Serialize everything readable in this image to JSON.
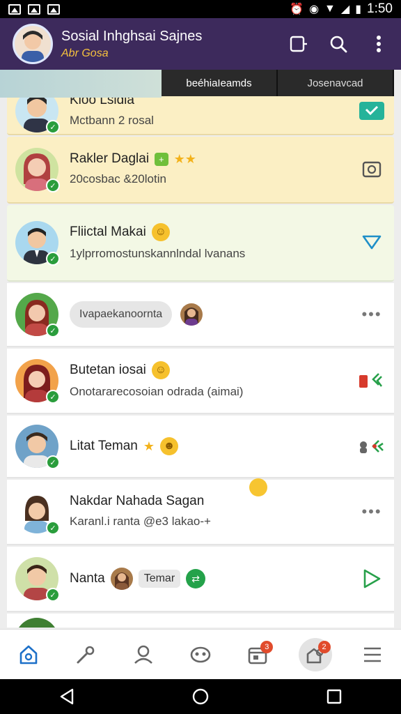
{
  "status_bar": {
    "time": "1:50"
  },
  "header": {
    "title": "Sosial Inhghsai Sajnes",
    "subtitle": "Abr Gosa",
    "accent": "#3d2a5c"
  },
  "tabs": [
    {
      "label": "beéhiaIeamds"
    },
    {
      "label": "Josenavcad"
    }
  ],
  "chats": [
    {
      "name": "Kloo Lsidia",
      "message": "Mctbann 2 rosal",
      "action_icon": "check-icon"
    },
    {
      "name": "Rakler Daglai",
      "message": "20cosbac &20lotin",
      "tag": "+",
      "action_icon": "camera-icon"
    },
    {
      "name": "Fliictal Makai",
      "message": "1ylprromostunskannlndal lvanans",
      "action_icon": "send-icon"
    },
    {
      "chip": "Ivapaekanoornta",
      "action_icon": "more-icon"
    },
    {
      "name": "Butetan iosai",
      "message": "Onotararecosoian odrada (aimai)",
      "action_icon": "share-icon"
    },
    {
      "name": "Litat Teman",
      "action_icon": "share-icon"
    },
    {
      "name": "Nakdar Nahada Sagan",
      "message": "Karanl.i ranta @e3 lakao-+",
      "action_icon": "more-icon"
    },
    {
      "name": "Nanta",
      "label": "Temar",
      "action_icon": "play-icon"
    }
  ],
  "bottom_nav": [
    {
      "icon": "home-icon",
      "badge": ""
    },
    {
      "icon": "key-icon",
      "badge": ""
    },
    {
      "icon": "person-icon",
      "badge": ""
    },
    {
      "icon": "mask-icon",
      "badge": ""
    },
    {
      "icon": "calendar-icon",
      "badge": "3"
    },
    {
      "icon": "community-icon",
      "badge": "2"
    },
    {
      "icon": "menu-icon",
      "badge": ""
    }
  ]
}
